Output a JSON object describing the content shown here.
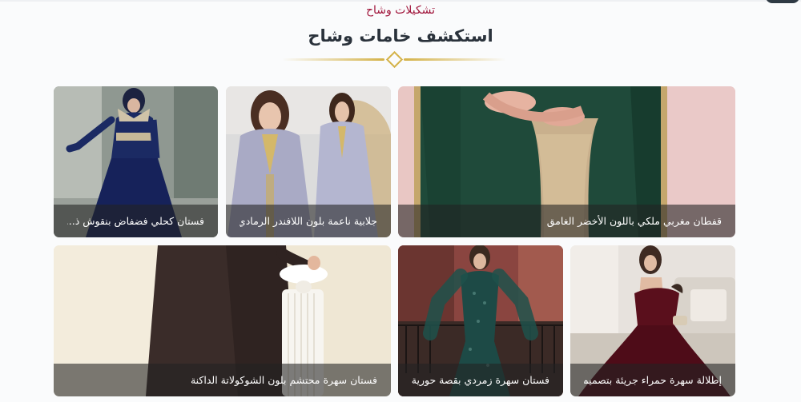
{
  "header": {
    "eyebrow": "تشكيلات وشاح",
    "title": "استكشف خامات وشاح"
  },
  "colors": {
    "accent_red": "#a0143a",
    "gold": "#d4b248",
    "heading": "#2a323b"
  },
  "cards": [
    {
      "caption": "قفطان مغربي ملكي باللون الأخضر الغامق",
      "image": "green-caftan-photo"
    },
    {
      "caption": "جلابية ناعمة بلون اللافندر الرمادي...",
      "image": "lavender-jalabiya-photo"
    },
    {
      "caption": "فستان كحلي فضفاض بنقوش ذ...",
      "image": "navy-dress-photo"
    },
    {
      "caption": "فستان سهرة محتشم بلون الشوكولاتة الداكنة",
      "image": "chocolate-dress-photo"
    },
    {
      "caption": "فستان سهرة زمردي بقصة حورية ا...",
      "image": "emerald-mermaid-dress-photo"
    },
    {
      "caption": "إطلالة سهرة حمراء جريئة بتصميم ...",
      "image": "red-evening-dress-photo"
    }
  ]
}
